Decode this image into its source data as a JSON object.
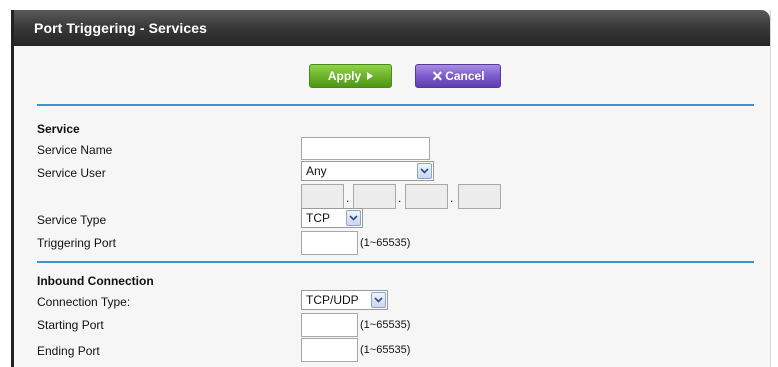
{
  "header": {
    "title": "Port Triggering - Services"
  },
  "actions": {
    "apply_label": "Apply",
    "cancel_label": "Cancel"
  },
  "service": {
    "section_title": "Service",
    "name_label": "Service Name",
    "name_value": "",
    "user_label": "Service User",
    "user_value": "Any",
    "ip_octets": [
      "",
      "",
      "",
      ""
    ],
    "type_label": "Service Type",
    "type_value": "TCP",
    "trigger_label": "Triggering Port",
    "trigger_value": "",
    "trigger_range": "(1~65535)"
  },
  "inbound": {
    "section_title": "Inbound Connection",
    "conn_type_label": "Connection Type:",
    "conn_type_value": "TCP/UDP",
    "start_label": "Starting Port",
    "start_value": "",
    "start_range": "(1~65535)",
    "end_label": "Ending Port",
    "end_value": "",
    "end_range": "(1~65535)"
  },
  "icons": {
    "apply": "play-triangle-icon",
    "cancel": "x-icon",
    "dropdown": "chevron-down-icon"
  },
  "colors": {
    "apply_green": "#6cb42a",
    "cancel_purple": "#7c5ccc",
    "divider_blue": "#3f93c8",
    "title_bar": "#333333"
  }
}
